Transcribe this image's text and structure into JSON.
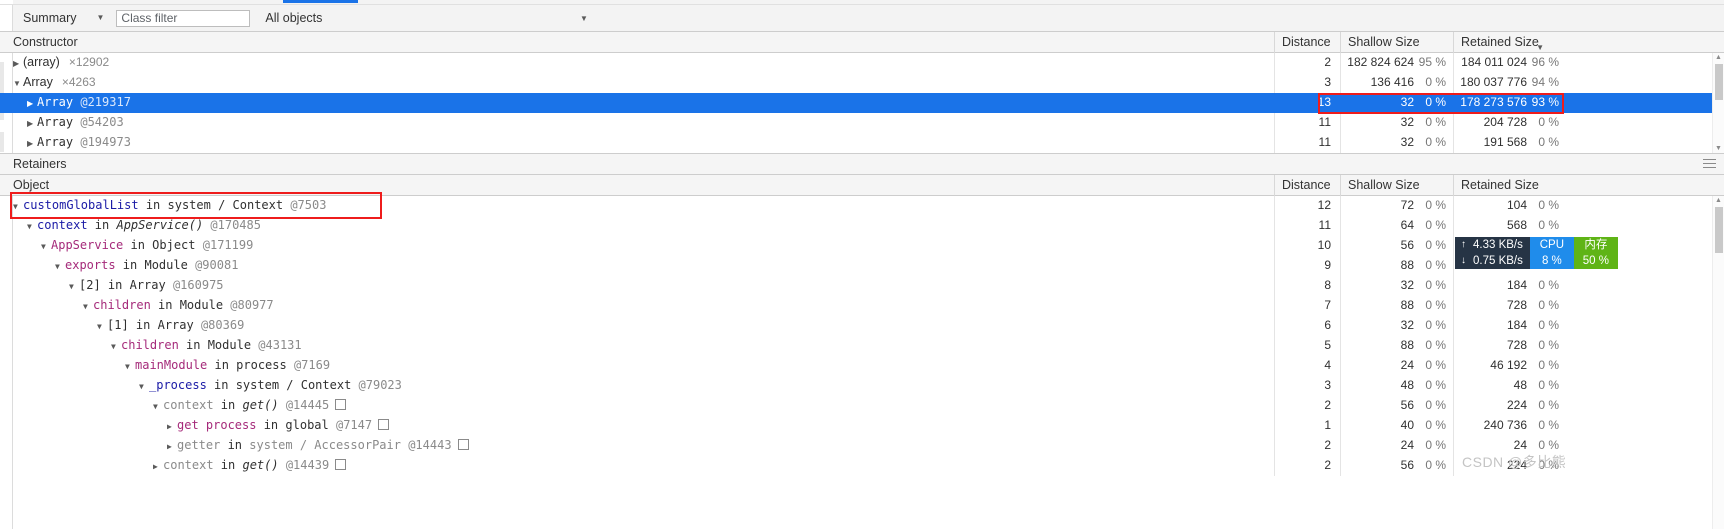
{
  "toolbar": {
    "view_select": "Summary",
    "view_caret": "▼",
    "class_filter_placeholder": "Class filter",
    "class_filter_value": "",
    "objects_select": "All objects",
    "objects_caret": "▼"
  },
  "constructor_grid": {
    "columns": {
      "constructor": "Constructor",
      "distance": "Distance",
      "shallow_size": "Shallow Size",
      "retained_size": "Retained Size",
      "sort_caret": "▼"
    },
    "rows": [
      {
        "triangle": "▶",
        "name": "(array)",
        "count": "×12902",
        "objid": "",
        "indent": 0,
        "selected": false,
        "distance": "2",
        "shallow": "182 824 624",
        "shallow_pct": "95 %",
        "retained": "184 011 024",
        "retained_pct": "96 %"
      },
      {
        "triangle": "▼",
        "name": "Array",
        "count": "×4263",
        "objid": "",
        "indent": 0,
        "selected": false,
        "distance": "3",
        "shallow": "136 416",
        "shallow_pct": "0 %",
        "retained": "180 037 776",
        "retained_pct": "94 %"
      },
      {
        "triangle": "▶",
        "name": "Array",
        "count": "",
        "objid": "@219317",
        "indent": 1,
        "selected": true,
        "distance": "13",
        "shallow": "32",
        "shallow_pct": "0 %",
        "retained": "178 273 576",
        "retained_pct": "93 %"
      },
      {
        "triangle": "▶",
        "name": "Array",
        "count": "",
        "objid": "@54203",
        "indent": 1,
        "selected": false,
        "distance": "11",
        "shallow": "32",
        "shallow_pct": "0 %",
        "retained": "204 728",
        "retained_pct": "0 %"
      },
      {
        "triangle": "▶",
        "name": "Array",
        "count": "",
        "objid": "@194973",
        "indent": 1,
        "selected": false,
        "distance": "11",
        "shallow": "32",
        "shallow_pct": "0 %",
        "retained": "191 568",
        "retained_pct": "0 %"
      }
    ]
  },
  "retainers_section": {
    "title": "Retainers",
    "columns": {
      "object": "Object",
      "distance": "Distance",
      "shallow_size": "Shallow Size",
      "retained_size": "Retained Size"
    },
    "rows": [
      {
        "triangle": "▼",
        "indent": 0,
        "prop": "customGlobalList",
        "prop_color": "blue",
        "kw": "in",
        "cls": "system / Context",
        "cls_style": "plain",
        "objid": "@7503",
        "box": false,
        "distance": "12",
        "shallow": "72",
        "shallow_pct": "0 %",
        "retained": "104",
        "retained_pct": "0 %"
      },
      {
        "triangle": "▼",
        "indent": 1,
        "prop": "context",
        "prop_color": "blue",
        "kw": "in",
        "cls": "AppService()",
        "cls_style": "italic",
        "objid": "@170485",
        "box": false,
        "distance": "11",
        "shallow": "64",
        "shallow_pct": "0 %",
        "retained": "568",
        "retained_pct": "0 %"
      },
      {
        "triangle": "▼",
        "indent": 2,
        "prop": "AppService",
        "prop_color": "pink",
        "kw": "in",
        "cls": "Object",
        "cls_style": "plain",
        "objid": "@171199",
        "box": false,
        "distance": "10",
        "shallow": "56",
        "shallow_pct": "0 %",
        "retained": "",
        "retained_pct": ""
      },
      {
        "triangle": "▼",
        "indent": 3,
        "prop": "exports",
        "prop_color": "pink",
        "kw": "in",
        "cls": "Module",
        "cls_style": "plain",
        "objid": "@90081",
        "box": false,
        "distance": "9",
        "shallow": "88",
        "shallow_pct": "0 %",
        "retained": "",
        "retained_pct": ""
      },
      {
        "triangle": "▼",
        "indent": 4,
        "prop": "[2]",
        "prop_color": "index",
        "kw": "in",
        "cls": "Array",
        "cls_style": "plain",
        "objid": "@160975",
        "box": false,
        "distance": "8",
        "shallow": "32",
        "shallow_pct": "0 %",
        "retained": "184",
        "retained_pct": "0 %"
      },
      {
        "triangle": "▼",
        "indent": 5,
        "prop": "children",
        "prop_color": "pink",
        "kw": "in",
        "cls": "Module",
        "cls_style": "plain",
        "objid": "@80977",
        "box": false,
        "distance": "7",
        "shallow": "88",
        "shallow_pct": "0 %",
        "retained": "728",
        "retained_pct": "0 %"
      },
      {
        "triangle": "▼",
        "indent": 6,
        "prop": "[1]",
        "prop_color": "index",
        "kw": "in",
        "cls": "Array",
        "cls_style": "plain",
        "objid": "@80369",
        "box": false,
        "distance": "6",
        "shallow": "32",
        "shallow_pct": "0 %",
        "retained": "184",
        "retained_pct": "0 %"
      },
      {
        "triangle": "▼",
        "indent": 7,
        "prop": "children",
        "prop_color": "pink",
        "kw": "in",
        "cls": "Module",
        "cls_style": "plain",
        "objid": "@43131",
        "box": false,
        "distance": "5",
        "shallow": "88",
        "shallow_pct": "0 %",
        "retained": "728",
        "retained_pct": "0 %"
      },
      {
        "triangle": "▼",
        "indent": 8,
        "prop": "mainModule",
        "prop_color": "pink",
        "kw": "in",
        "cls": "process",
        "cls_style": "plain",
        "objid": "@7169",
        "box": false,
        "distance": "4",
        "shallow": "24",
        "shallow_pct": "0 %",
        "retained": "46 192",
        "retained_pct": "0 %"
      },
      {
        "triangle": "▼",
        "indent": 9,
        "prop": "_process",
        "prop_color": "blue",
        "kw": "in",
        "cls": "system / Context",
        "cls_style": "plain",
        "objid": "@79023",
        "box": false,
        "distance": "3",
        "shallow": "48",
        "shallow_pct": "0 %",
        "retained": "48",
        "retained_pct": "0 %"
      },
      {
        "triangle": "▼",
        "indent": 10,
        "prop": "context",
        "prop_color": "gray",
        "kw": "in",
        "cls": "get()",
        "cls_style": "italic",
        "objid": "@14445",
        "box": true,
        "distance": "2",
        "shallow": "56",
        "shallow_pct": "0 %",
        "retained": "224",
        "retained_pct": "0 %"
      },
      {
        "triangle": "▶",
        "indent": 11,
        "prop": "get process",
        "prop_color": "pink",
        "kw": "in",
        "cls": "global",
        "cls_style": "plain",
        "objid": "@7147",
        "box": true,
        "distance": "1",
        "shallow": "40",
        "shallow_pct": "0 %",
        "retained": "240 736",
        "retained_pct": "0 %"
      },
      {
        "triangle": "▶",
        "indent": 11,
        "prop": "getter",
        "prop_color": "gray",
        "kw": "in",
        "cls": "system / AccessorPair",
        "cls_style": "gray",
        "objid": "@14443",
        "box": true,
        "distance": "2",
        "shallow": "24",
        "shallow_pct": "0 %",
        "retained": "24",
        "retained_pct": "0 %"
      },
      {
        "triangle": "▶",
        "indent": 10,
        "prop": "context",
        "prop_color": "gray",
        "kw": "in",
        "cls": "get()",
        "cls_style": "italic",
        "objid": "@14439",
        "box": true,
        "distance": "2",
        "shallow": "56",
        "shallow_pct": "0 %",
        "retained": "224",
        "retained_pct": "0 %"
      }
    ]
  },
  "net_monitor": {
    "upload_arrow": "↑",
    "download_arrow": "↓",
    "upload_rate": "4.33 KB/s",
    "download_rate": "0.75 KB/s",
    "cpu_label": "CPU",
    "cpu_value": "8 %",
    "mem_label": "内存",
    "mem_value": "50 %",
    "colors": {
      "net_bg": "#263445",
      "cpu_bg": "#1f8ceb",
      "mem_bg": "#5fb416"
    }
  },
  "annotations": {
    "highlight_color": "#ee1c1c",
    "watermark": "CSDN @多比熊"
  }
}
